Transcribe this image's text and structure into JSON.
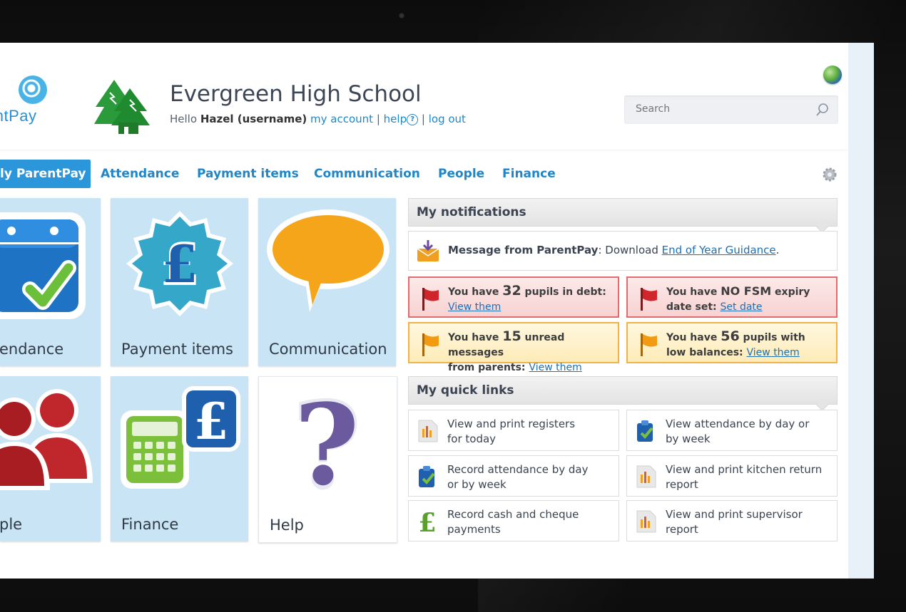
{
  "header": {
    "logo_text": "entPay",
    "school_name": "Evergreen High School",
    "hello_prefix": "Hello",
    "user": "Hazel (username)",
    "my_account": "my account",
    "sep1": "|",
    "help": "help",
    "help_icon": "?",
    "sep2": "|",
    "logout": "log out"
  },
  "search": {
    "placeholder": "Search"
  },
  "nav": {
    "items": [
      "ly ParentPay",
      "Attendance",
      "Payment items",
      "Communication",
      "People",
      "Finance"
    ],
    "active": "ly ParentPay"
  },
  "tiles": {
    "attendance": "endance",
    "payment_items": "Payment items",
    "communication": "Communication",
    "people": "ple",
    "finance": "Finance",
    "help": "Help"
  },
  "notifications": {
    "title": "My notifications",
    "message": {
      "from": "Message from ParentPay",
      "text": ": Download ",
      "link": "End of Year Guidance",
      "end": "."
    },
    "alerts": [
      {
        "pre": "You have ",
        "num": "32",
        "post": " pupils in debt:",
        "link": "View them",
        "type": "red"
      },
      {
        "pre": "You have ",
        "num": "NO FSM",
        "post": " expiry",
        "line2": "date set: ",
        "link": "Set date",
        "type": "red"
      },
      {
        "pre": "You have ",
        "num": "15",
        "post": " unread messages",
        "line2": "from parents: ",
        "link": "View them",
        "type": "amber"
      },
      {
        "pre": "You have ",
        "num": "56",
        "post": " pupils with",
        "line2": "low balances: ",
        "link": "View them",
        "type": "amber"
      }
    ]
  },
  "quick_links": {
    "title": "My quick links",
    "items": [
      {
        "l1": "View and print registers",
        "l2": "for today",
        "icon": "chart-doc-icon"
      },
      {
        "l1": "View attendance by day or",
        "l2": "by week",
        "icon": "clipboard-check-icon"
      },
      {
        "l1": "Record attendance by day",
        "l2": "or by week",
        "icon": "clipboard-check-icon"
      },
      {
        "l1": "View and print kitchen return",
        "l2": "report",
        "icon": "chart-doc-icon"
      },
      {
        "l1": "Record cash and cheque",
        "l2": "payments",
        "icon": "pound-icon"
      },
      {
        "l1": "View and print supervisor",
        "l2": "report",
        "icon": "chart-doc-icon"
      }
    ]
  },
  "colors": {
    "accent": "#2b97da",
    "link": "#1f86c8",
    "tile_bg": "#c9e4f5"
  }
}
